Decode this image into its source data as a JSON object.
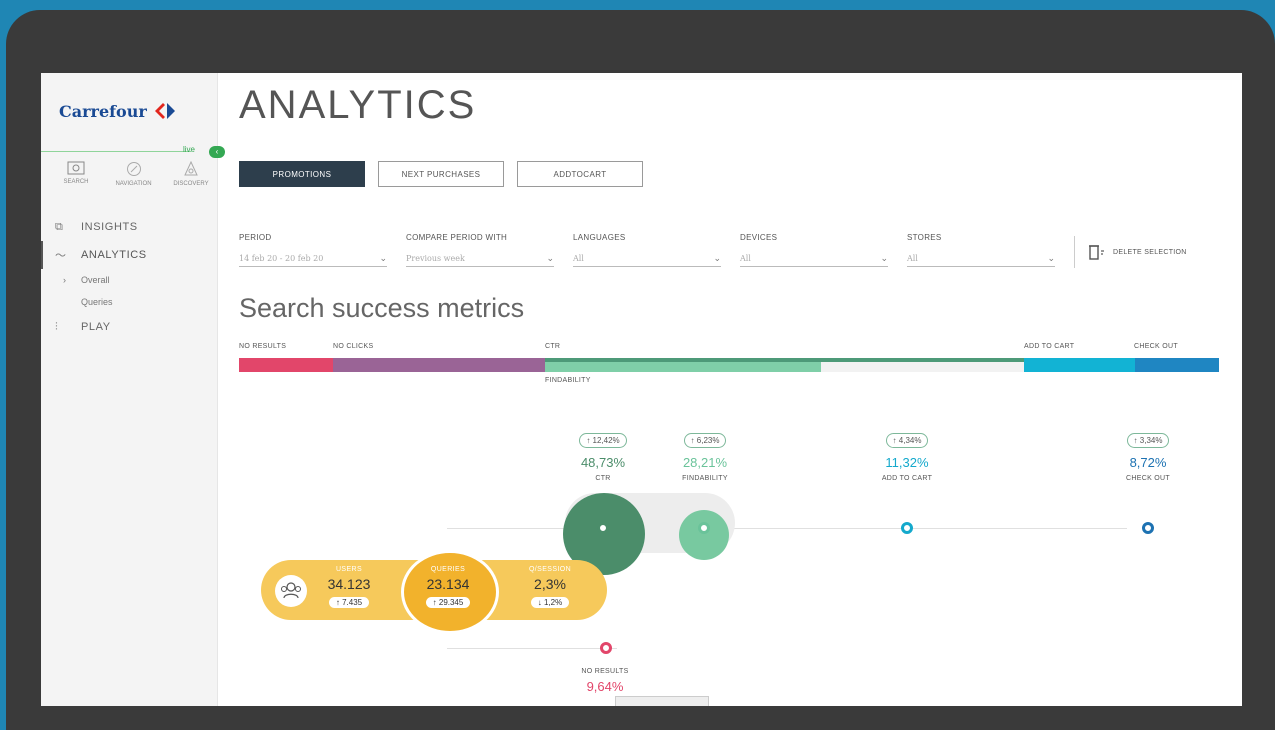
{
  "brand": {
    "name": "Carrefour",
    "color": "#1a4a94"
  },
  "live": {
    "label": "live"
  },
  "modes": [
    {
      "label": "SEARCH",
      "icon": "search-mode-icon"
    },
    {
      "label": "NAVIGATION",
      "icon": "navigation-icon"
    },
    {
      "label": "DISCOVERY",
      "icon": "discovery-icon"
    }
  ],
  "nav": {
    "insights": "INSIGHTS",
    "analytics": "ANALYTICS",
    "overall": "Overall",
    "queries": "Queries",
    "play": "PLAY"
  },
  "page": {
    "title": "ANALYTICS"
  },
  "tabs": [
    "PROMOTIONS",
    "NEXT PURCHASES",
    "ADDTOCART"
  ],
  "filters": [
    {
      "label": "PERIOD",
      "value": "14 feb 20 - 20 feb 20"
    },
    {
      "label": "COMPARE PERIOD WITH",
      "value": "Previous week"
    },
    {
      "label": "LANGUAGES",
      "value": "All"
    },
    {
      "label": "DEVICES",
      "value": "All"
    },
    {
      "label": "STORES",
      "value": "All"
    }
  ],
  "delete_selection": "DELETE SELECTION",
  "section_title": "Search success metrics",
  "funnel_bar": {
    "labels": {
      "no_results": "NO RESULTS",
      "no_clicks": "NO CLICKS",
      "ctr": "CTR",
      "add_to_cart": "ADD TO CART",
      "check_out": "CHECK OUT",
      "findability": "FINDABILITY"
    },
    "colors": [
      "#e2466a",
      "#9a6496",
      "#4d9a78",
      "#7fcfa8",
      "#f2f2f2",
      "#12b3d4",
      "#1f86c2"
    ]
  },
  "metrics": [
    {
      "delta": "↑ 12,42%",
      "value": "48,73%",
      "label": "CTR",
      "color": "#4b8d6a"
    },
    {
      "delta": "↑ 6,23%",
      "value": "28,21%",
      "label": "FINDABILITY",
      "color": "#6ac39a"
    },
    {
      "delta": "↑ 4,34%",
      "value": "11,32%",
      "label": "ADD TO CART",
      "color": "#14a9cc"
    },
    {
      "delta": "↑ 3,34%",
      "value": "8,72%",
      "label": "CHECK OUT",
      "color": "#1d72b2"
    }
  ],
  "kpis": [
    {
      "label": "USERS",
      "value": "34.123",
      "delta": "↑ 7.435"
    },
    {
      "label": "QUERIES",
      "value": "23.134",
      "delta": "↑ 29.345"
    },
    {
      "label": "Q/SESSION",
      "value": "2,3%",
      "delta": "↓ 1,2%"
    }
  ],
  "no_results": {
    "label": "NO RESULTS",
    "value": "9,64%"
  }
}
